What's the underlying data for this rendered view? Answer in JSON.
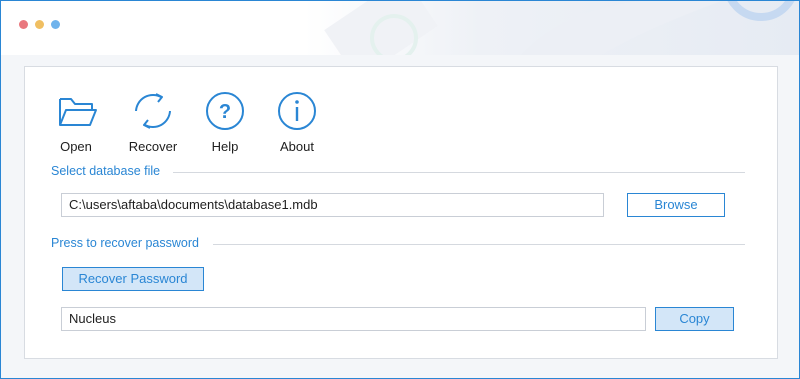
{
  "window": {
    "controls": [
      "close",
      "minimize",
      "maximize"
    ]
  },
  "toolbar": {
    "items": [
      {
        "label": "Open",
        "icon": "folder-open-icon"
      },
      {
        "label": "Recover",
        "icon": "refresh-icon"
      },
      {
        "label": "Help",
        "icon": "question-circle-icon"
      },
      {
        "label": "About",
        "icon": "info-circle-icon"
      }
    ]
  },
  "select_section": {
    "title": "Select database file",
    "file_path": "C:\\users\\aftaba\\documents\\database1.mdb",
    "browse_label": "Browse"
  },
  "recover_section": {
    "title": "Press to recover password",
    "recover_label": "Recover Password",
    "result_value": "Nucleus",
    "copy_label": "Copy"
  },
  "colors": {
    "accent": "#2a86d4",
    "button_fill": "#d3e6f8",
    "border": "#c9ced6",
    "dot_red": "#e9787e",
    "dot_yellow": "#f0bf62",
    "dot_blue": "#6fb3ec"
  }
}
